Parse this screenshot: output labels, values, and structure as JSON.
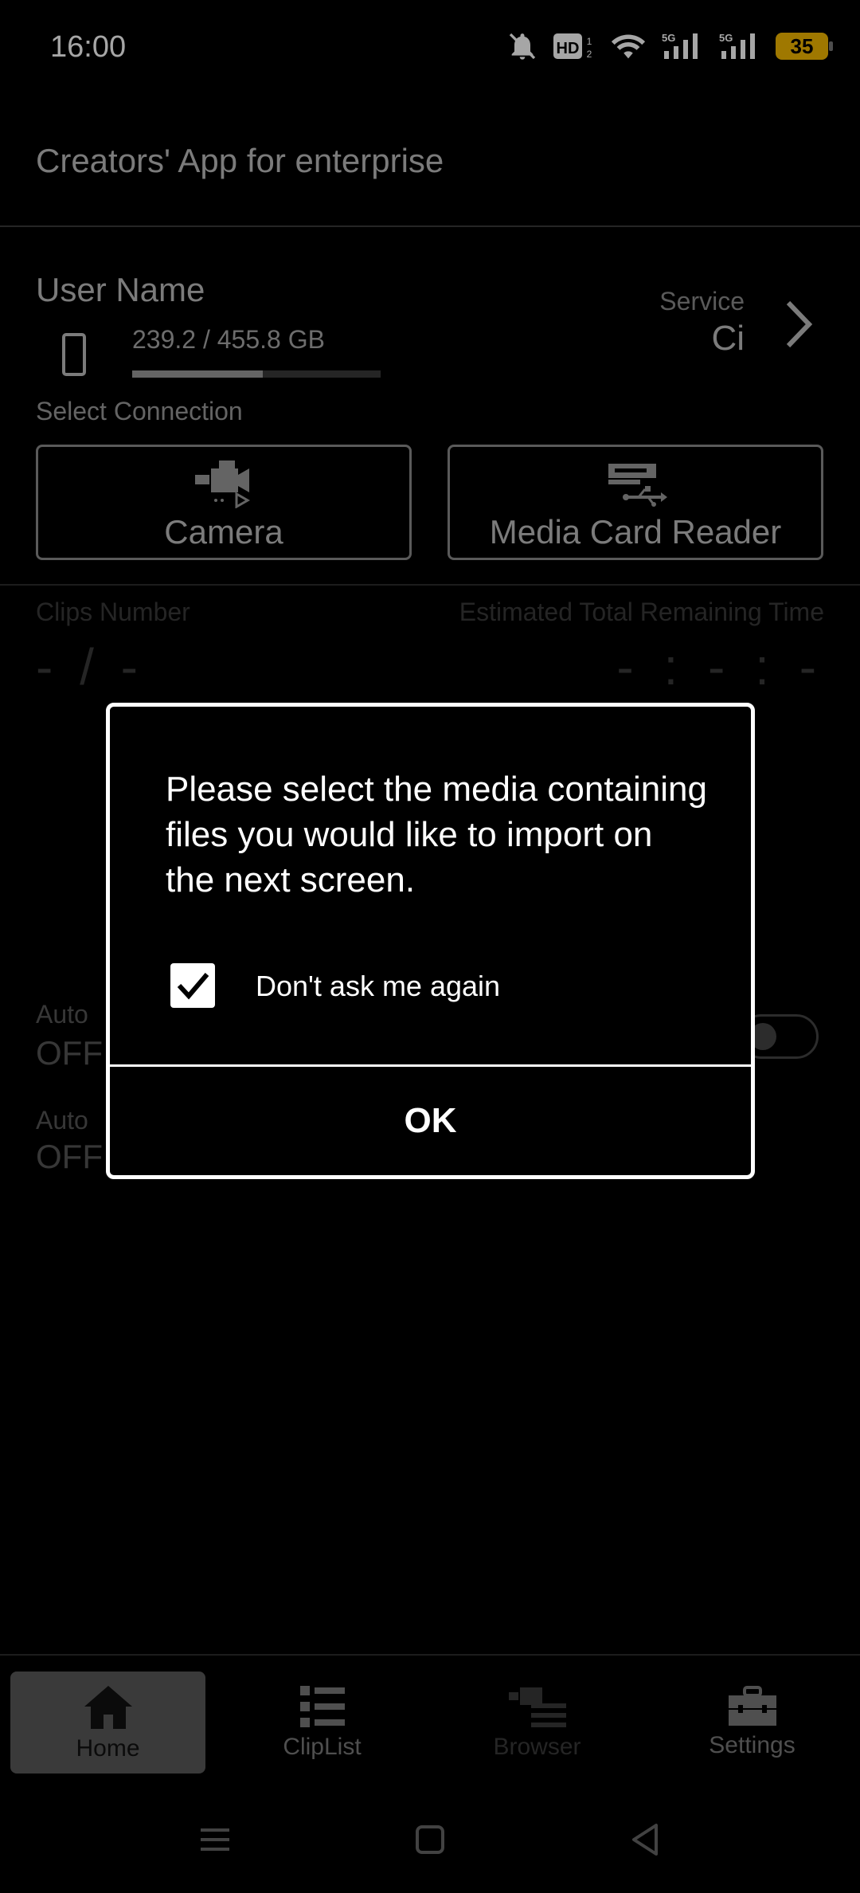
{
  "status_bar": {
    "time": "16:00",
    "icons": [
      "bell-off-icon",
      "hd-icon",
      "wifi-icon",
      "signal-5g-icon",
      "signal-5g-icon"
    ],
    "battery": "35",
    "battery_color": "#f5b800"
  },
  "header": {
    "title": "Creators' App for enterprise"
  },
  "user": {
    "name": "User Name",
    "storage_text": "239.2 / 455.8 GB",
    "storage_used": 239.2,
    "storage_total": 455.8
  },
  "service": {
    "label": "Service",
    "value": "Ci"
  },
  "connection": {
    "label": "Select Connection",
    "camera": "Camera",
    "card_reader": "Media Card Reader"
  },
  "clips": {
    "label": "Clips Number",
    "value": "- / -",
    "remaining_label": "Estimated Total Remaining Time",
    "remaining_value": "- : - : -"
  },
  "auto": [
    {
      "label": "Auto",
      "value": "OFF"
    },
    {
      "label": "Auto",
      "value": "OFF"
    }
  ],
  "dialog": {
    "message": "Please select the media containing files you would like to import on the next screen.",
    "checkbox_label": "Don't ask me again",
    "checkbox_checked": true,
    "ok_label": "OK"
  },
  "nav": {
    "home": "Home",
    "cliplist": "ClipList",
    "browser": "Browser",
    "settings": "Settings"
  }
}
